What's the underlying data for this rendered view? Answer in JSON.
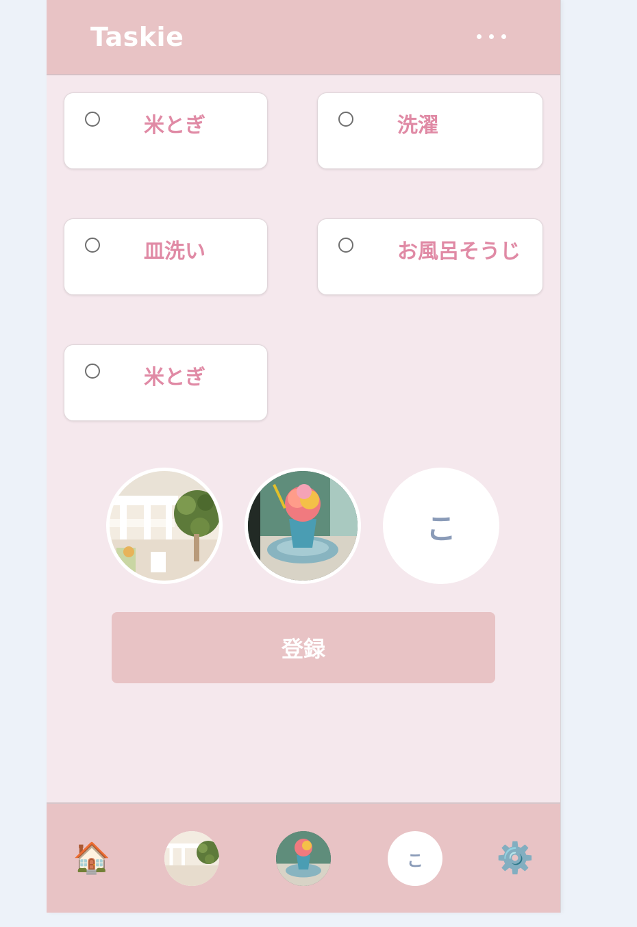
{
  "app": {
    "title": "Taskie",
    "menu_icon": "more-horizontal-icon"
  },
  "tasks": [
    {
      "label": "米とぎ",
      "checked": false
    },
    {
      "label": "洗濯",
      "checked": false
    },
    {
      "label": "皿洗い",
      "checked": false
    },
    {
      "label": "お風呂そうじ",
      "checked": false
    },
    {
      "label": "米とぎ",
      "checked": false
    }
  ],
  "members": [
    {
      "type": "photo",
      "icon": "interior-plant-photo"
    },
    {
      "type": "photo",
      "icon": "shaved-ice-photo"
    },
    {
      "type": "initial",
      "initial": "こ"
    }
  ],
  "register_button": {
    "label": "登録"
  },
  "bottom_nav": {
    "home_icon": "🏠",
    "settings_icon": "⚙️",
    "member_initial": "こ"
  },
  "colors": {
    "header": "#e8c3c5",
    "background": "#f5e8ed",
    "task_text": "#e08aa5",
    "initial_text": "#8a9bb8"
  }
}
